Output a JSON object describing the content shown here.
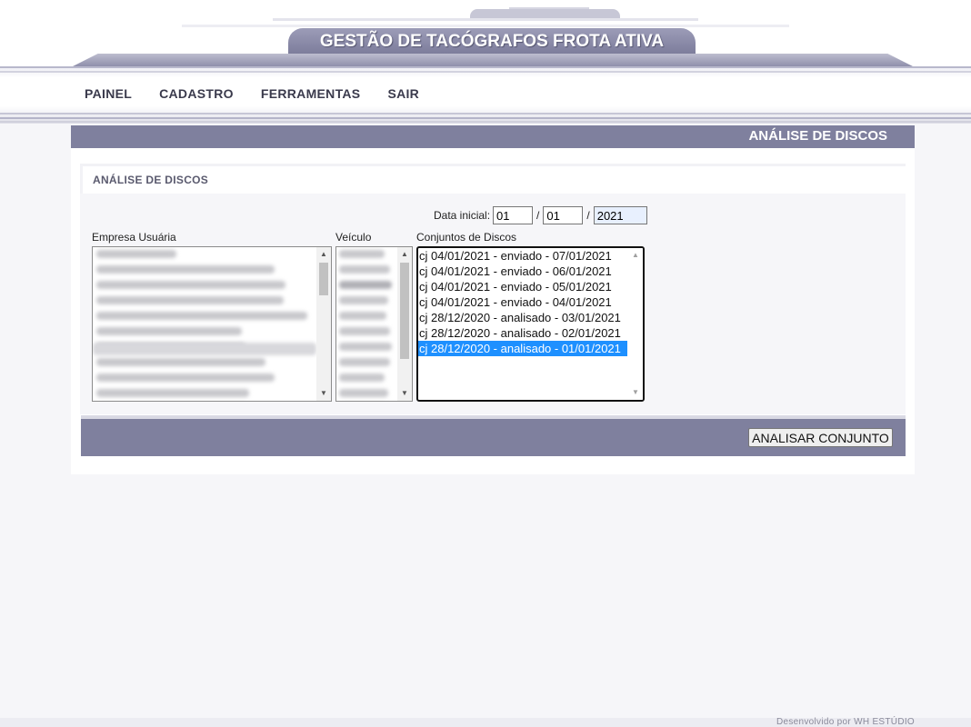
{
  "header": {
    "title": "GESTÃO DE TACÓGRAFOS FROTA ATIVA"
  },
  "nav": {
    "items": [
      "PAINEL",
      "CADASTRO",
      "FERRAMENTAS",
      "SAIR"
    ]
  },
  "page": {
    "bar_title": "ANÁLISE DE DISCOS",
    "section_title": "ANÁLISE DE DISCOS"
  },
  "form": {
    "date_label": "Data inicial:",
    "date_day": "01",
    "date_month": "01",
    "date_year": "2021",
    "date_sep": "/",
    "company_label": "Empresa Usuária",
    "vehicle_label": "Veículo",
    "discs_label": "Conjuntos de Discos",
    "discs": [
      "cj 04/01/2021 - enviado - 07/01/2021",
      "cj 04/01/2021 - enviado - 06/01/2021",
      "cj 04/01/2021 - enviado - 05/01/2021",
      "cj 04/01/2021 - enviado - 04/01/2021",
      "cj 28/12/2020 - analisado - 03/01/2021",
      "cj 28/12/2020 - analisado - 02/01/2021",
      "cj 28/12/2020 - analisado - 01/01/2021"
    ],
    "selected_disc_index": 6,
    "analyze_button": "ANALISAR CONJUNTO"
  },
  "footer": {
    "credit": "Desenvolvido por WH ESTÚDIO"
  },
  "colors": {
    "accent_bar": "#7f809e",
    "selection": "#1e90ff"
  }
}
